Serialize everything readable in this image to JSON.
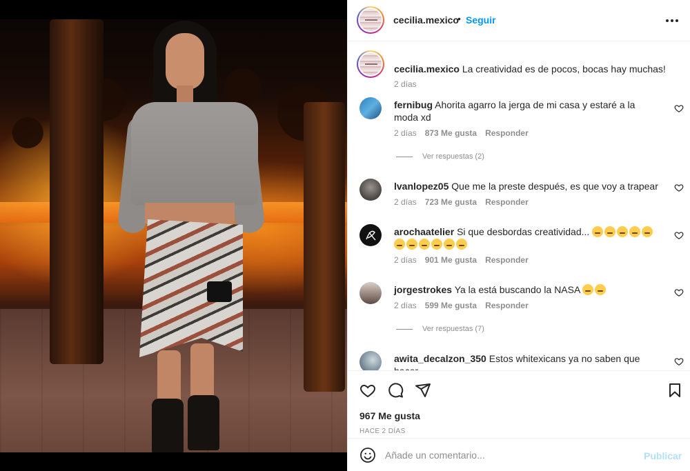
{
  "post": {
    "author": "cecilia.mexico",
    "follow_label": "Seguir",
    "separator": "•",
    "more_icon": "more-horizontal-icon",
    "caption": {
      "username": "cecilia.mexico",
      "text": "La creatividad es de pocos, bocas hay muchas!",
      "time": "2 días"
    }
  },
  "comments": [
    {
      "username": "fernibug",
      "text": "Ahorita agarro la jerga de mi casa y estaré a la moda xd",
      "time": "2 días",
      "likes": "873 Me gusta",
      "reply_label": "Responder",
      "avatar_color": "#3a8ccf",
      "view_replies": "Ver respuestas (2)"
    },
    {
      "username": "lvanlopez05",
      "text": "Que me la preste después, es que voy a trapear",
      "time": "2 días",
      "likes": "723 Me gusta",
      "reply_label": "Responder",
      "avatar_color": "#6d6a66"
    },
    {
      "username": "arochaatelier",
      "text": "Si que desbordas creatividad...",
      "emoji_count": 11,
      "time": "2 días",
      "likes": "901 Me gusta",
      "reply_label": "Responder",
      "avatar_color": "#111111"
    },
    {
      "username": "jorgestrokes",
      "text": "Ya la está buscando la NASA",
      "emoji_count": 2,
      "time": "2 días",
      "likes": "599 Me gusta",
      "reply_label": "Responder",
      "avatar_color": "#b9a7a0",
      "view_replies": "Ver respuestas (7)"
    },
    {
      "username": "awita_decalzon_350",
      "text": "Estos whitexicans ya no saben que hacer",
      "avatar_color": "#8aa0b0"
    }
  ],
  "actions": {
    "icons": [
      "heart-icon",
      "comment-icon",
      "share-icon",
      "save-icon"
    ],
    "likes": "967 Me gusta",
    "ago": "Hace 2 días"
  },
  "add_comment": {
    "placeholder": "Añade un comentario...",
    "publish_label": "Publicar",
    "publish_color": "#b2dffc"
  },
  "colors": {
    "link": "#0095f6",
    "muted": "#8e8e8e",
    "text": "#262626"
  }
}
